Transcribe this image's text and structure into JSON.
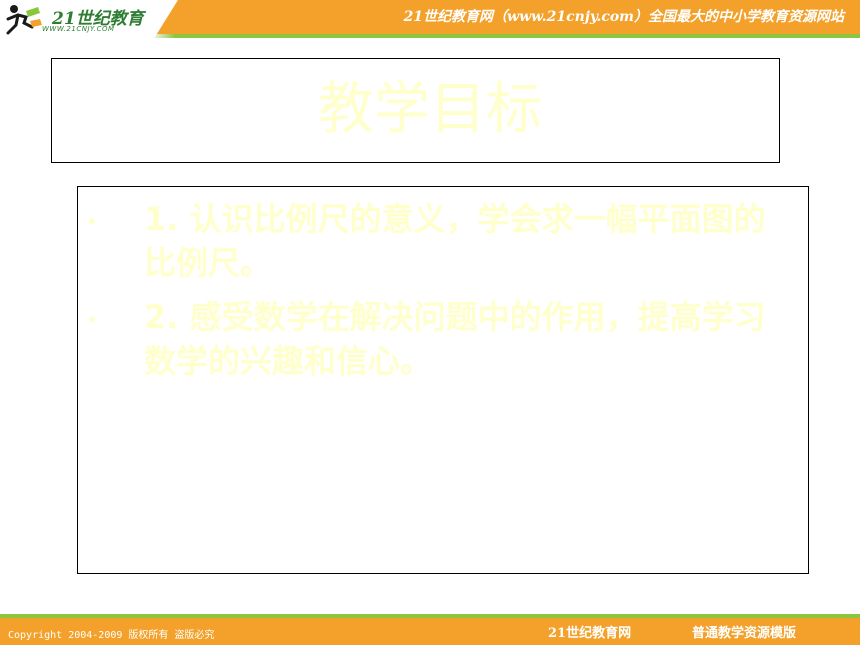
{
  "header": {
    "logo_name": "21世纪教育",
    "logo_url": "WWW.21CNJY.COM",
    "title": "21世纪教育网（www.21cnjy.com）全国最大的中小学教育资源网站"
  },
  "slide": {
    "title": "教学目标",
    "objectives": [
      {
        "bullet": "•",
        "text": "1. 认识比例尺的意义，学会求一幅平面图的比例尺。"
      },
      {
        "bullet": "•",
        "text": "2. 感受数学在解决问题中的作用，提高学习数学的兴趣和信心。"
      }
    ]
  },
  "footer": {
    "copyright": "Copyright 2004-2009 版权所有 盗版必究",
    "site": "21世纪教育网",
    "template": "普通教学资源模版"
  },
  "colors": {
    "header_orange": "#f3a12b",
    "accent_green": "#8cc63f",
    "text_pale_yellow": "#ffffcc"
  }
}
